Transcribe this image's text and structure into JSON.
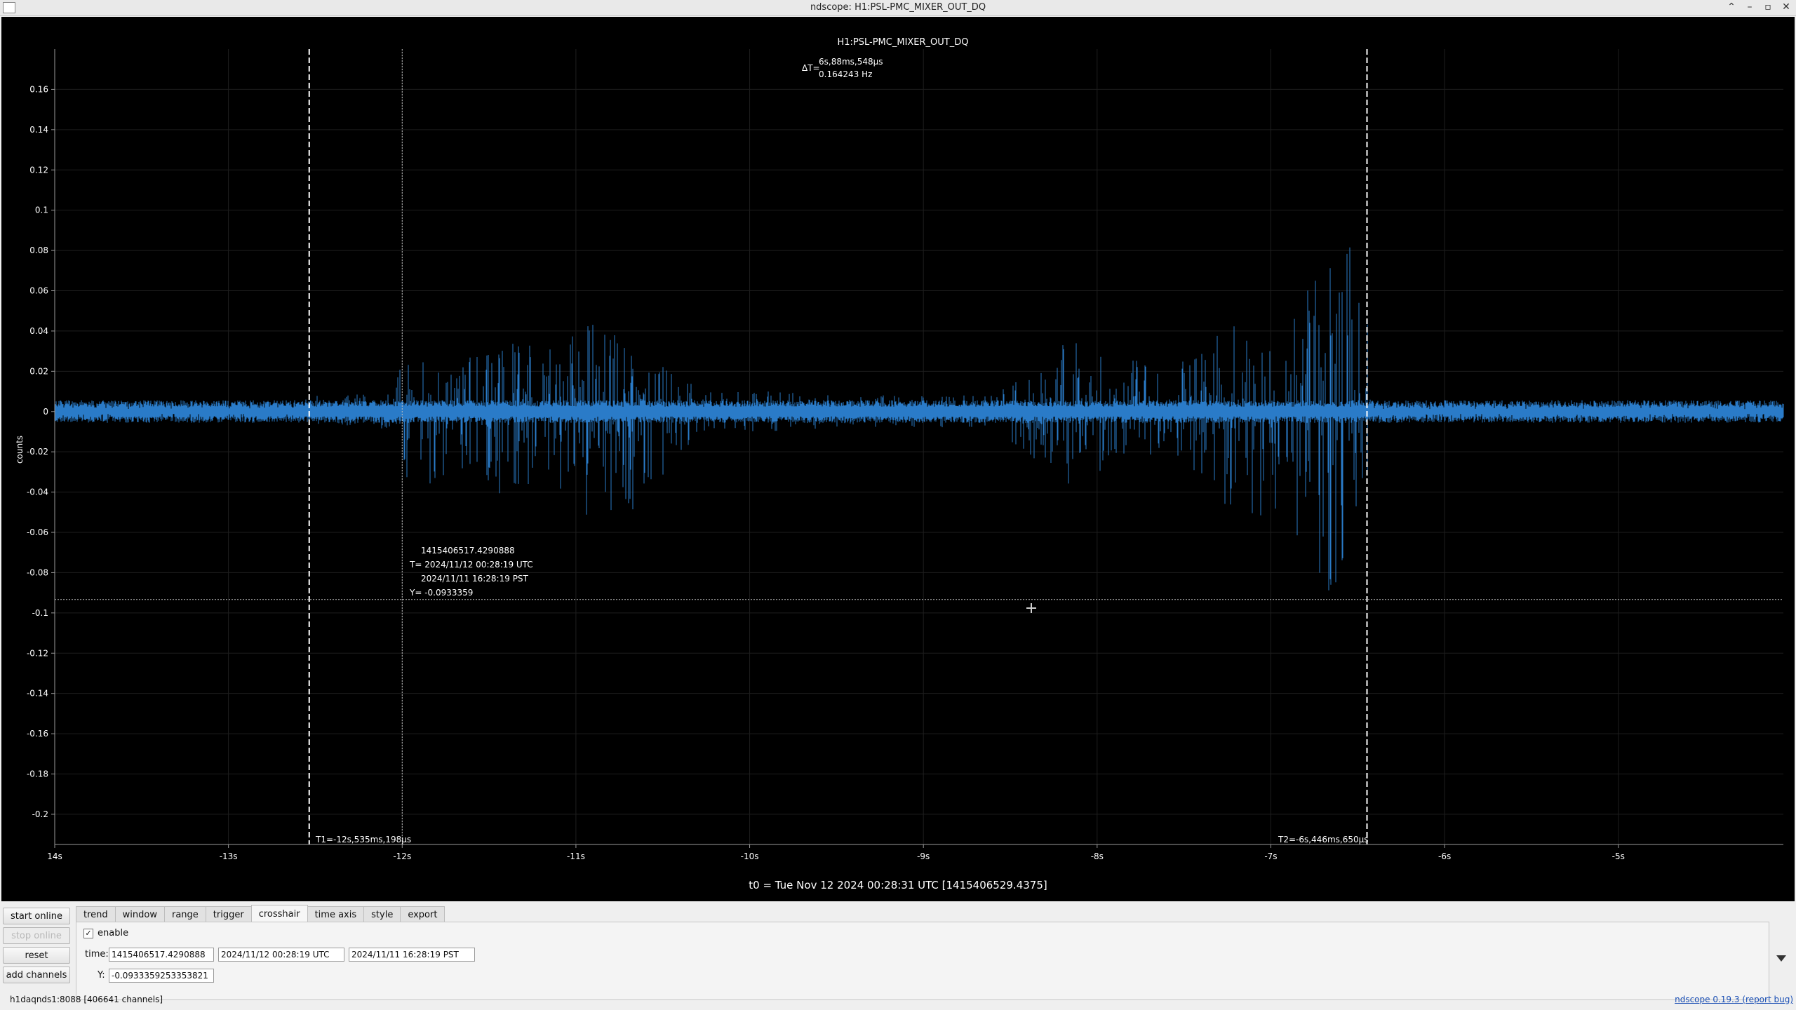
{
  "window": {
    "title": "ndscope: H1:PSL-PMC_MIXER_OUT_DQ",
    "buttons": [
      "⌃",
      "–",
      "▫",
      "✕"
    ]
  },
  "plot": {
    "channel_title": "H1:PSL-PMC_MIXER_OUT_DQ",
    "delta_label": "ΔT=",
    "delta_time": "6s,88ms,548μs",
    "delta_freq": "0.164243 Hz",
    "cursor_t1": "T1=-12s,535ms,198μs",
    "cursor_t2": "T2=-6s,446ms,650μs",
    "crosshair_gps": "1415406517.4290888",
    "crosshair_utc": "T= 2024/11/12 00:28:19 UTC",
    "crosshair_pst": "2024/11/11 16:28:19 PST",
    "crosshair_y": "Y= -0.0933359",
    "t0_label": "t0 = Tue Nov 12 2024 00:28:31 UTC [1415406529.4375]",
    "trace_color": "#2a7bc8"
  },
  "chart_data": {
    "type": "line",
    "title": "H1:PSL-PMC_MIXER_OUT_DQ",
    "xlabel": "",
    "ylabel": "counts",
    "xlim": [
      -14,
      -4.05
    ],
    "ylim": [
      -0.215,
      0.18
    ],
    "x_ticks": [
      -14,
      -13,
      -12,
      -11,
      -10,
      -9,
      -8,
      -7,
      -6,
      -5
    ],
    "x_tick_labels": [
      "14s",
      "-13s",
      "-12s",
      "-11s",
      "-10s",
      "-9s",
      "-8s",
      "-7s",
      "-6s",
      "-5s"
    ],
    "y_ticks": [
      0.16,
      0.14,
      0.12,
      0.1,
      0.08,
      0.06,
      0.04,
      0.02,
      0,
      -0.02,
      -0.04,
      -0.06,
      -0.08,
      -0.1,
      -0.12,
      -0.14,
      -0.16,
      -0.18,
      -0.2
    ],
    "y_tick_labels": [
      "0.16",
      "0.14",
      "0.12",
      "0.1",
      "0.08",
      "0.06",
      "0.04",
      "0.02",
      "0",
      "-0.02",
      "-0.04",
      "-0.06",
      "-0.08",
      "-0.1",
      "-0.12",
      "-0.14",
      "-0.16",
      "-0.18",
      "-0.2"
    ],
    "grid": true,
    "cursors": {
      "t1": -12.535198,
      "t2": -6.44665,
      "crosshair_x": -12.0,
      "crosshair_y": -0.0933359
    },
    "series": [
      {
        "values_envelope": [
          {
            "x": -14.0,
            "max": 0.004,
            "min": -0.004
          },
          {
            "x": -12.6,
            "max": 0.005,
            "min": -0.004
          },
          {
            "x": -12.5,
            "max": 0.008,
            "min": -0.006
          },
          {
            "x": -12.05,
            "max": 0.01,
            "min": -0.01
          },
          {
            "x": -12.0,
            "max": 0.025,
            "min": -0.02
          },
          {
            "x": -11.95,
            "max": 0.03,
            "min": -0.045
          },
          {
            "x": -11.7,
            "max": 0.018,
            "min": -0.03
          },
          {
            "x": -11.55,
            "max": 0.034,
            "min": -0.043
          },
          {
            "x": -11.35,
            "max": 0.035,
            "min": -0.04
          },
          {
            "x": -11.15,
            "max": 0.032,
            "min": -0.038
          },
          {
            "x": -11.0,
            "max": 0.045,
            "min": -0.054
          },
          {
            "x": -10.9,
            "max": 0.046,
            "min": -0.054
          },
          {
            "x": -10.6,
            "max": 0.028,
            "min": -0.048
          },
          {
            "x": -10.3,
            "max": 0.012,
            "min": -0.012
          },
          {
            "x": -9.5,
            "max": 0.008,
            "min": -0.008
          },
          {
            "x": -8.6,
            "max": 0.008,
            "min": -0.008
          },
          {
            "x": -8.15,
            "max": 0.038,
            "min": -0.042
          },
          {
            "x": -7.9,
            "max": 0.035,
            "min": -0.03
          },
          {
            "x": -7.6,
            "max": 0.02,
            "min": -0.02
          },
          {
            "x": -7.25,
            "max": 0.045,
            "min": -0.047
          },
          {
            "x": -7.0,
            "max": 0.03,
            "min": -0.06
          },
          {
            "x": -6.8,
            "max": 0.06,
            "min": -0.085
          },
          {
            "x": -6.7,
            "max": 0.075,
            "min": -0.09
          },
          {
            "x": -6.55,
            "max": 0.085,
            "min": -0.092
          },
          {
            "x": -6.45,
            "max": 0.09,
            "min": -0.05
          },
          {
            "x": -6.42,
            "max": 0.004,
            "min": -0.004
          },
          {
            "x": -4.05,
            "max": 0.004,
            "min": -0.004
          }
        ]
      }
    ]
  },
  "controls": {
    "start_online": "start online",
    "stop_online": "stop online",
    "reset": "reset",
    "add_channels": "add channels",
    "tabs": [
      "trend",
      "window",
      "range",
      "trigger",
      "crosshair",
      "time axis",
      "style",
      "export"
    ],
    "active_tab": "crosshair",
    "enable_label": "enable",
    "time_label": "time:",
    "time_gps": "1415406517.4290888",
    "time_utc": "2024/11/12 00:28:19 UTC",
    "time_pst": "2024/11/11 16:28:19 PST",
    "y_label": "Y:",
    "y_value": "-0.0933359253353821"
  },
  "status": {
    "server": "h1daqnds1:8088  [406641 channels]",
    "version_link": "ndscope 0.19.3",
    "bug_link": "(report bug)"
  }
}
